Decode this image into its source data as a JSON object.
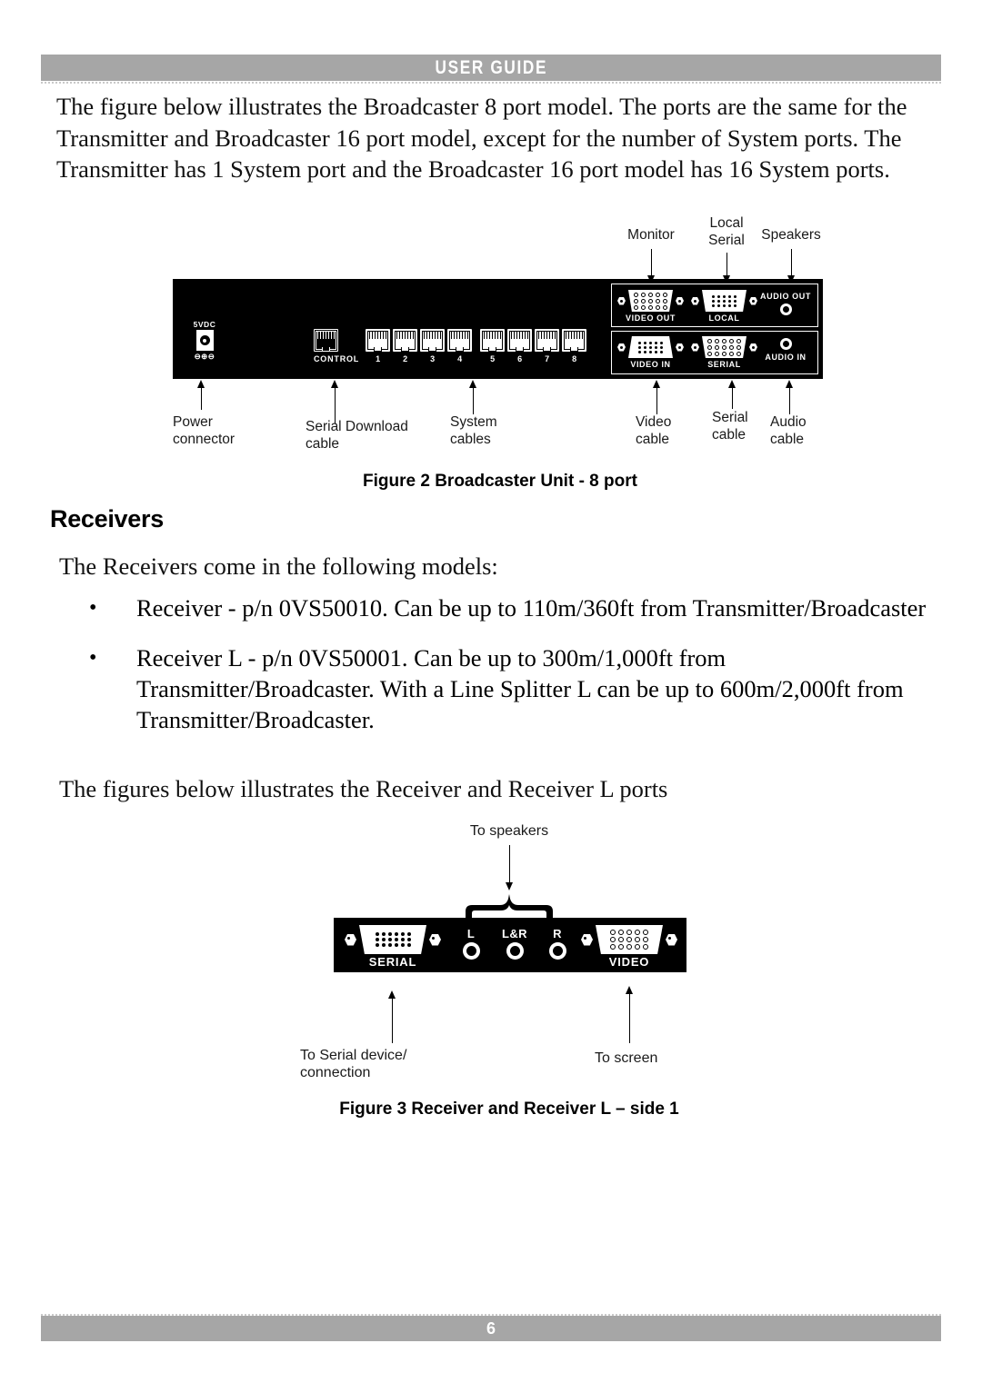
{
  "header": {
    "title": "USER GUIDE"
  },
  "footer": {
    "page_number": "6"
  },
  "body": {
    "intro_paragraph": "The figure below illustrates the Broadcaster 8 port model. The ports are the same for the Transmitter and Broadcaster 16 port model, except for the number of System ports. The Transmitter has 1 System port and the Broadcaster 16 port model has 16 System ports.",
    "receivers_heading": "Receivers",
    "models_intro": "The Receivers come in the following models:",
    "bullets": [
      {
        "marker": "•",
        "text": "Receiver - p/n 0VS50010. Can be up to 110m/360ft from Transmitter/Broadcaster"
      },
      {
        "marker": "•",
        "text": "Receiver L - p/n 0VS50001. Can be up to 300m/1,000ft from Transmitter/Broadcaster. With a Line Splitter L can be up to 600m/2,000ft from Transmitter/Broadcaster."
      }
    ],
    "figures_intro": "The figures below illustrates the Receiver and Receiver L ports"
  },
  "figure2": {
    "caption": "Figure 2 Broadcaster Unit - 8 port",
    "top_labels": [
      {
        "text": "Monitor"
      },
      {
        "text": "Local\nSerial"
      },
      {
        "text": "Speakers"
      }
    ],
    "bottom_labels": [
      {
        "text": "Power\nconnector"
      },
      {
        "text": "Serial Download\ncable"
      },
      {
        "text": "System\ncables"
      },
      {
        "text": "Video\ncable"
      },
      {
        "text": "Serial\ncable"
      },
      {
        "text": "Audio\ncable"
      }
    ],
    "panel": {
      "power_label_top": "5VDC",
      "power_label_bottom": "⊖⊕⊖",
      "control_label": "CONTROL",
      "system_port_numbers": [
        "1",
        "2",
        "3",
        "4",
        "5",
        "6",
        "7",
        "8"
      ],
      "ports": [
        {
          "name": "VIDEO OUT"
        },
        {
          "name": "LOCAL"
        },
        {
          "name": "AUDIO OUT"
        },
        {
          "name": "VIDEO IN"
        },
        {
          "name": "SERIAL"
        },
        {
          "name": "AUDIO IN"
        }
      ]
    }
  },
  "figure3": {
    "caption": "Figure 3 Receiver and Receiver L – side 1",
    "top_label": "To speakers",
    "bottom_labels": [
      {
        "text": "To Serial device/\nconnection"
      },
      {
        "text": "To screen"
      }
    ],
    "panel": {
      "serial_name": "SERIAL",
      "video_name": "VIDEO",
      "audio_labels": [
        "L",
        "L&R",
        "R"
      ]
    }
  },
  "colors": {
    "band": "#a6a6a6",
    "panel": "#000000",
    "band_text": "#ffffff"
  }
}
